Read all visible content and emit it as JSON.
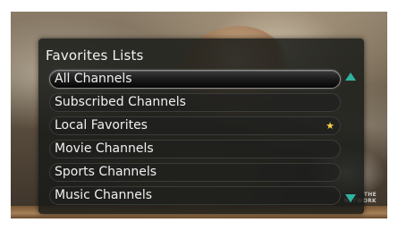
{
  "panel": {
    "title": "Favorites Lists",
    "items": [
      {
        "label": "All Channels",
        "selected": true,
        "favorite": false
      },
      {
        "label": "Subscribed Channels",
        "selected": false,
        "favorite": false
      },
      {
        "label": "Local Favorites",
        "selected": false,
        "favorite": true
      },
      {
        "label": "Movie Channels",
        "selected": false,
        "favorite": false
      },
      {
        "label": "Sports Channels",
        "selected": false,
        "favorite": false
      },
      {
        "label": "Music Channels",
        "selected": false,
        "favorite": false
      }
    ]
  },
  "icons": {
    "scroll_up": "triangle-up-icon",
    "scroll_down": "triangle-down-icon",
    "favorite": "star-icon"
  },
  "colors": {
    "accent": "#2fb3a0",
    "star": "#f7d24a",
    "panel_bg": "#181a18"
  },
  "background": {
    "watermark_line1": "THE",
    "watermark_line2": "NETWORK"
  }
}
